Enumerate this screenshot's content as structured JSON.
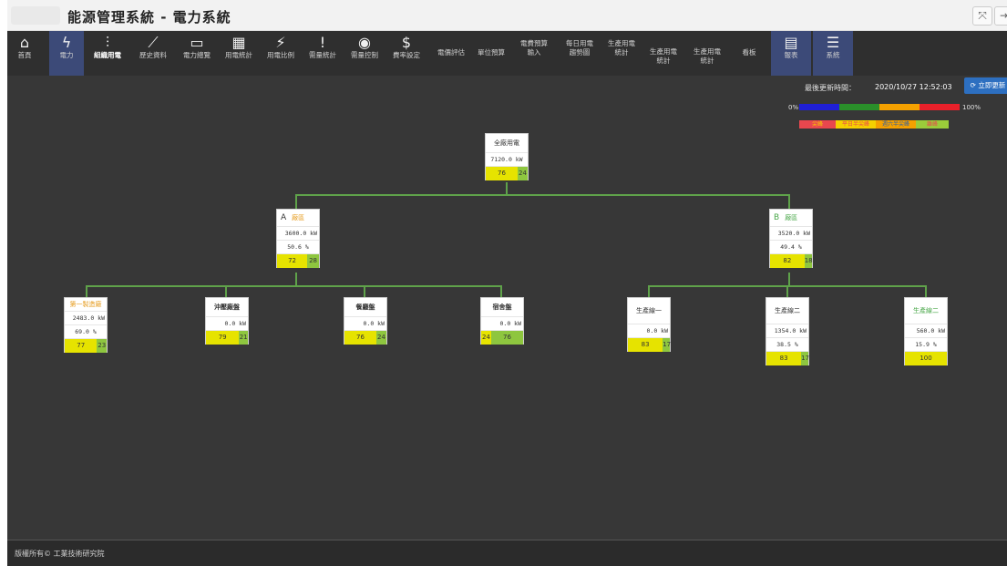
{
  "app": {
    "title": "能源管理系統 - 電力系統"
  },
  "nav": {
    "items": [
      {
        "label": "首頁",
        "icon": "home-icon",
        "glyph": "⌂"
      },
      {
        "label": "電力",
        "icon": "lightning-icon",
        "glyph": "ϟ"
      },
      {
        "label": "組織用電",
        "icon": "org-chart-icon",
        "glyph": "⫶"
      },
      {
        "label": "歷史資料",
        "icon": "line-chart-icon",
        "glyph": "📈"
      },
      {
        "label": "電力總覽",
        "icon": "monitor-icon",
        "glyph": "▭"
      },
      {
        "label": "用電統計",
        "icon": "calculator-icon",
        "glyph": "▦"
      },
      {
        "label": "用電比例",
        "icon": "plug-icon",
        "glyph": "⚡"
      },
      {
        "label": "需量統計",
        "icon": "exclamation-icon",
        "glyph": "!"
      },
      {
        "label": "需量控制",
        "icon": "record-icon",
        "glyph": "◉"
      },
      {
        "label": "費率設定",
        "icon": "dollar-icon",
        "glyph": "$"
      },
      {
        "label": "電價評估"
      },
      {
        "label": "單位預算"
      },
      {
        "label": "電費預算\n輸入"
      },
      {
        "label": "每日用電\n趨勢圖"
      },
      {
        "label": "生產用電\n統計"
      },
      {
        "label": "生產用電\n統計"
      },
      {
        "label": "生產用電\n統計"
      },
      {
        "label": "看板"
      },
      {
        "label": "報表",
        "icon": "report-icon",
        "glyph": "▤"
      },
      {
        "label": "系統",
        "icon": "list-icon",
        "glyph": "☰"
      }
    ]
  },
  "update": {
    "label": "最後更新時間：",
    "time": "2020/10/27 12:52:03",
    "refresh_label": "⟳ 立即更新"
  },
  "legend": {
    "min": "0%",
    "max": "100%",
    "bar_colors": [
      "#1f1fd6",
      "#2a8f2a",
      "#f5a100",
      "#e8202a"
    ],
    "items": [
      {
        "label": "尖峰",
        "color": "#e8474e",
        "text_color": "#f5d000"
      },
      {
        "label": "平日半尖峰",
        "color": "#f5d000",
        "text_color": "#e8474e"
      },
      {
        "label": "週六半尖峰",
        "color": "#f5a100",
        "text_color": "#2a5ea8"
      },
      {
        "label": "離峰",
        "color": "#9bcc3a",
        "text_color": "#e8474e"
      }
    ]
  },
  "tree": {
    "root": {
      "name": "全廠用電",
      "kw": "7120.0 kW",
      "bars": [
        "76",
        "24"
      ]
    },
    "a": {
      "letter": "A",
      "name": "廠區",
      "kw": "3600.0 kW",
      "pct": "50.6 %",
      "bars": [
        "72",
        "28"
      ]
    },
    "b": {
      "letter": "B",
      "name": "廠區",
      "kw": "3520.0 kW",
      "pct": "49.4 %",
      "bars": [
        "82",
        "18"
      ]
    },
    "a1": {
      "name": "第一製造廠",
      "kw": "2483.0 kW",
      "pct": "69.0 %",
      "bars": [
        "77",
        "23"
      ]
    },
    "a2": {
      "name": "沖壓廠盤",
      "kw": "0.0 kW",
      "bars": [
        "79",
        "21"
      ]
    },
    "a3": {
      "name": "餐廳盤",
      "kw": "0.0 kW",
      "bars": [
        "76",
        "24"
      ]
    },
    "a4": {
      "name": "宿舍盤",
      "kw": "0.0 kW",
      "bars": [
        "24",
        "76"
      ]
    },
    "b1": {
      "name": "生產線一",
      "kw": "0.0 kW",
      "bars": [
        "83",
        "17"
      ]
    },
    "b2": {
      "name": "生產線二",
      "kw": "1354.0 kW",
      "pct": "38.5 %",
      "bars": [
        "83",
        "17"
      ]
    },
    "b3": {
      "name": "生產線二",
      "kw": "560.0 kW",
      "pct": "15.9 %",
      "bars": [
        "100"
      ]
    }
  },
  "footer": {
    "text": "版權所有© 工業技術研究院"
  }
}
